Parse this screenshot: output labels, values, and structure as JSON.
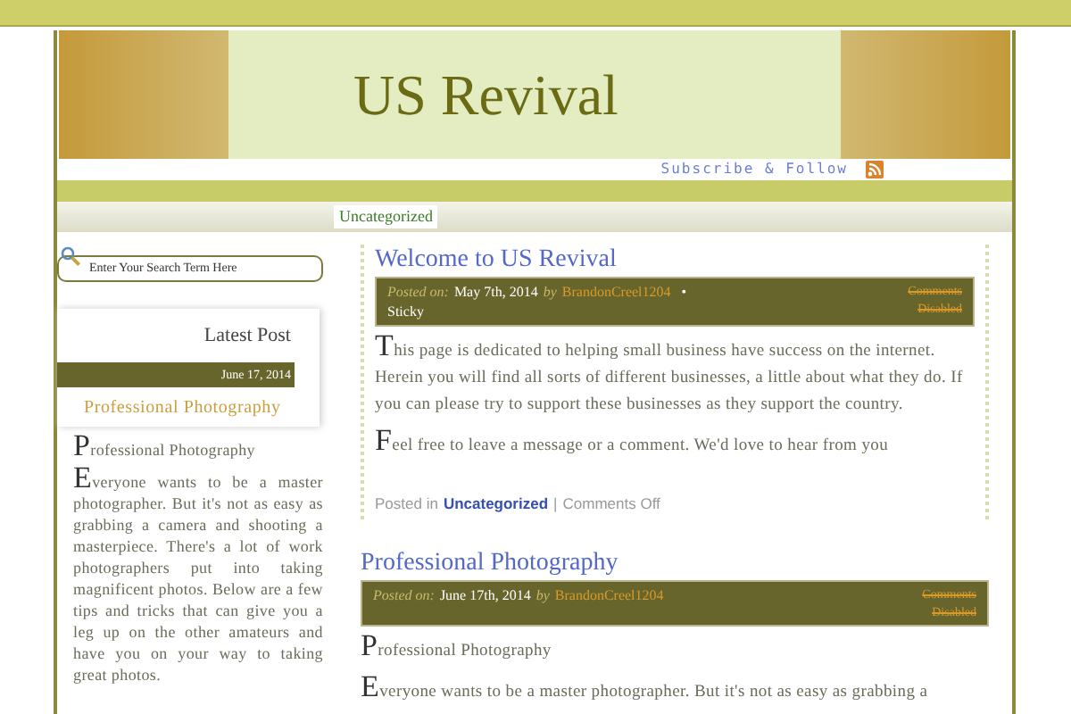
{
  "header": {
    "title": "US Revival",
    "subscribe": "Subscribe & Follow"
  },
  "nav": [
    {
      "label": "Uncategorized",
      "selected": true
    }
  ],
  "search": {
    "placeholder": "Enter Your Search Term Here"
  },
  "sidebar": {
    "heading": "Latest Post",
    "date": "June 17, 2014",
    "post_title": "Professional Photography",
    "paragraphs": [
      "Professional Photography",
      "Everyone wants to be a master photographer. But it's not as easy as grabbing a camera and shooting a masterpiece. There's a lot of work photographers put into taking magnificent photos. Below are a few tips and tricks that can give you a leg up on the other amateurs and have you on your way to taking great photos."
    ]
  },
  "posts": [
    {
      "title": "Welcome to US Revival",
      "posted_on": "Posted on:",
      "date": "May 7th, 2014",
      "by": "by",
      "author": "BrandonCreel1204",
      "bullet": "•",
      "tag": "Sticky",
      "comments": "Comments Disabled",
      "paragraphs": [
        "This page is dedicated to helping small business have success on the internet. Herein you will find all sorts of different businesses, a little about what they do. If you can please try to support these businesses as they support the country.",
        "Feel free to leave a message or a comment. We'd love to hear from you"
      ],
      "footer": {
        "posted_in": "Posted in",
        "category": "Uncategorized",
        "separator": "|",
        "comments": "Comments Off"
      }
    },
    {
      "title": "Professional Photography",
      "posted_on": "Posted on:",
      "date": "June 17th, 2014",
      "by": "by",
      "author": "BrandonCreel1204",
      "comments": "Comments Disabled",
      "paragraphs": [
        "Professional Photography",
        "Everyone wants to be a master photographer. But it's not as easy as grabbing a"
      ]
    }
  ]
}
